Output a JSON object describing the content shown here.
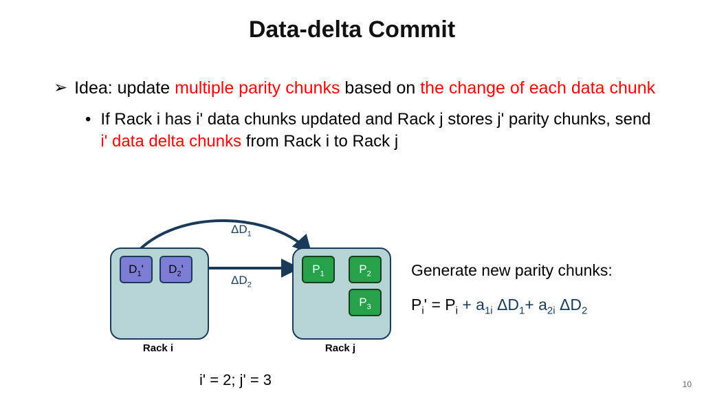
{
  "title": "Data-delta Commit",
  "bullet": {
    "idea_prefix": "Idea: update ",
    "idea_red1": "multiple parity chunks",
    "idea_mid": " based on ",
    "idea_red2": "the change of each data chunk",
    "sub_prefix": "If Rack i has i' data chunks updated and Rack j stores j' parity chunks, send ",
    "sub_red": "i' data delta chunks",
    "sub_suffix": " from Rack i to Rack j"
  },
  "diagram": {
    "d1": "D",
    "d1_sub": "1",
    "d1_prime": "'",
    "d2": "D",
    "d2_sub": "2",
    "d2_prime": "'",
    "p1": "P",
    "p1_sub": "1",
    "p2": "P",
    "p2_sub": "2",
    "p3": "P",
    "p3_sub": "3",
    "delta1_pre": "ΔD",
    "delta1_sub": "1",
    "delta2_pre": "ΔD",
    "delta2_sub": "2",
    "rack_i": "Rack i",
    "rack_j": "Rack j"
  },
  "counts": "i' = 2; j' = 3",
  "right": {
    "caption": "Generate new parity chunks:",
    "eq_lhs_base": "P",
    "eq_lhs_sub": "i",
    "eq_lhs_prime": "' = P",
    "eq_lhs_sub2": "i",
    "eq_plus": " + ",
    "a1_base": "a",
    "a1_sub": "1i",
    "sp": " ",
    "dd1": "ΔD",
    "dd1_sub": "1",
    "plus2": "+ ",
    "a2_base": "a",
    "a2_sub": "2i",
    "dd2": "ΔD",
    "dd2_sub": "2"
  },
  "page": "10"
}
